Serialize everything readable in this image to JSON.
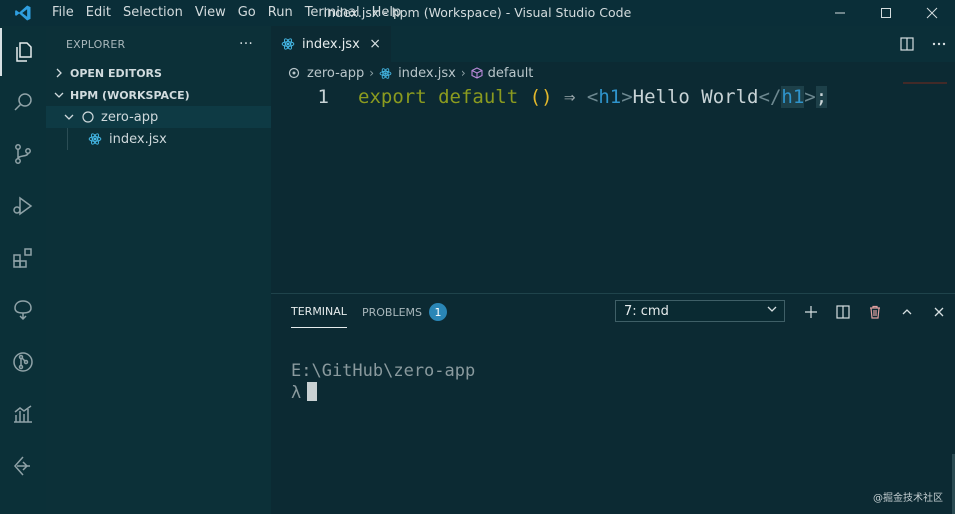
{
  "titlebar": {
    "menu": [
      "File",
      "Edit",
      "Selection",
      "View",
      "Go",
      "Run",
      "Terminal",
      "Help"
    ],
    "window_title": "index.jsx - hpm (Workspace) - Visual Studio Code"
  },
  "sidebar": {
    "header": "EXPLORER",
    "more": "···",
    "open_editors": "OPEN EDITORS",
    "workspace": "HPM (WORKSPACE)",
    "folder": "zero-app",
    "file": "index.jsx"
  },
  "editor": {
    "tab_label": "index.jsx",
    "tab_close": "×",
    "breadcrumb": [
      "zero-app",
      "index.jsx",
      "default"
    ],
    "line_number": "1",
    "code": {
      "kw1": "export",
      "kw2": "default",
      "parens": "()",
      "arrow": "⇒",
      "lt": "<",
      "tag": "h1",
      "gt": ">",
      "text": "Hello World",
      "close_lt": "</",
      "close_tag": "h1",
      "close_gt": ">",
      "semi": ";"
    }
  },
  "panel": {
    "terminal_tab": "TERMINAL",
    "problems_tab": "PROBLEMS",
    "problems_count": "1",
    "terminal_select": "7: cmd",
    "terminal_lines": [
      "E:\\GitHub\\zero-app",
      "λ"
    ]
  },
  "watermark": "@掘金技术社区",
  "colors": {
    "background": "#0c2a33",
    "keyword": "#8b9b1f",
    "paren": "#e3b82c",
    "tag": "#2f94cc",
    "badge": "#2a86b6"
  }
}
